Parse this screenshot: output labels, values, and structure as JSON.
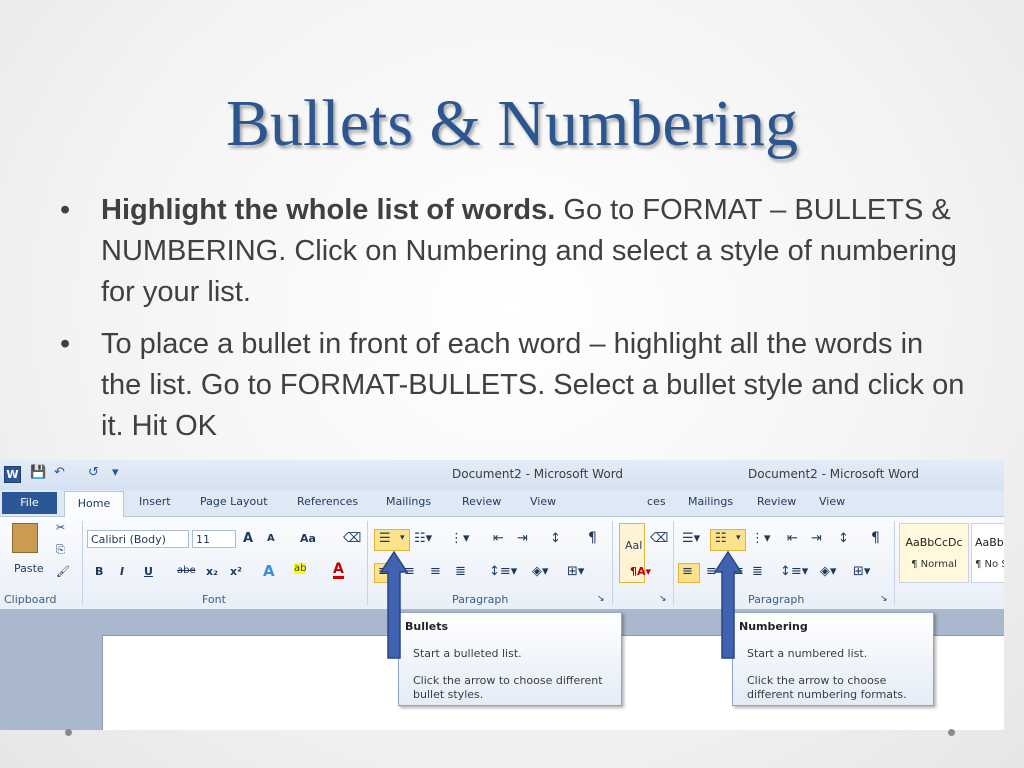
{
  "slide": {
    "title": "Bullets & Numbering",
    "bullet_char": "•",
    "bullets": [
      {
        "bold": "Highlight the whole list of words.",
        "text": " Go to FORMAT – BULLETS & NUMBERING.  Click on Numbering and select a style of numbering for your list."
      },
      {
        "bold": "",
        "text": "To place a bullet in front of each word – highlight all the words in the list.  Go to FORMAT-BULLETS.  Select a bullet style and click on it.  Hit OK"
      }
    ]
  },
  "word": {
    "logo": "W",
    "qat": {
      "save": "💾",
      "undo": "↶",
      "redo": "↺",
      "customize": "▾"
    },
    "title_left": "Document2 - Microsoft Word",
    "title_right": "Document2 - Microsoft Word",
    "tabs_left": {
      "file": "File",
      "home": "Home",
      "insert": "Insert",
      "page_layout": "Page Layout",
      "references": "References",
      "mailings": "Mailings",
      "review": "Review",
      "view": "View"
    },
    "tabs_right": {
      "ces": "ces",
      "mailings": "Mailings",
      "review": "Review",
      "view": "View"
    },
    "clipboard": {
      "paste": "Paste",
      "label": "Clipboard"
    },
    "font": {
      "name": "Calibri (Body)",
      "size": "11",
      "grow": "A",
      "shrink": "A",
      "change_case": "Aa",
      "bold": "B",
      "italic": "I",
      "underline": "U",
      "strike": "abe",
      "subscript": "x₂",
      "superscript": "x²",
      "label": "Font"
    },
    "paragraph": {
      "label": "Paragraph",
      "pilcrow": "¶"
    },
    "styles": {
      "sample1": "AaBbCcDc",
      "name1": "¶ Normal",
      "sample2": "AaBb",
      "name2": "¶ No S",
      "partial": "Aal"
    },
    "tooltip_bullets": {
      "title": "Bullets",
      "line1": "Start a bulleted list.",
      "line2": "Click the arrow to choose different bullet styles."
    },
    "tooltip_numbering": {
      "title": "Numbering",
      "line1": "Start a numbered list.",
      "line2": "Click the arrow to choose different numbering formats."
    }
  },
  "colors": {
    "title": "#2c5690",
    "arrow": "#3f63b0",
    "file_tab": "#2b5797",
    "highlight": "#fbe28c"
  }
}
